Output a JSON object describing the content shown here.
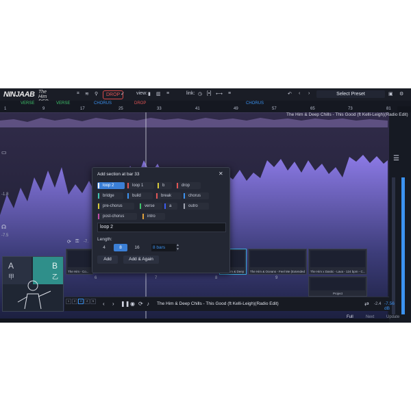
{
  "app": {
    "logo": "NINJAAB",
    "sublogo": "The Him DSP",
    "drop_label": "DROP",
    "view_label": "view:",
    "link_label": "link:",
    "preset_label": "Select Preset"
  },
  "sections": [
    {
      "label": "VERSE",
      "color": "#3fc46b"
    },
    {
      "label": "VERSE",
      "color": "#3fc46b"
    },
    {
      "label": "CHORUS",
      "color": "#3b92f0"
    },
    {
      "label": "DROP",
      "color": "#e05555"
    },
    {
      "label": "CHORUS",
      "color": "#3b92f0"
    }
  ],
  "ruler": [
    "1",
    "9",
    "17",
    "25",
    "33",
    "41",
    "49",
    "57",
    "65",
    "73",
    "81"
  ],
  "song_title": "The Him & Deep Chills - This Good (ft Kelli-Leigh)(Radio Edit)",
  "left_labels": {
    "label_a": "-1.8",
    "label_b": "-7.5",
    "label_c": "-7."
  },
  "dialog": {
    "title": "Add section at bar 33",
    "close": "✕",
    "chips": [
      {
        "label": "loop 2",
        "color": "#3b92f0",
        "selected": true
      },
      {
        "label": "loop 1",
        "color": "#e05555"
      },
      {
        "label": "b",
        "color": "#d6c93a"
      },
      {
        "label": "drop",
        "color": "#e05555"
      },
      {
        "label": "bridge",
        "color": "#3fc4b0"
      },
      {
        "label": "build",
        "color": "#3b92f0"
      },
      {
        "label": "break",
        "color": "#e05555"
      },
      {
        "label": "chorus",
        "color": "#3b92f0"
      },
      {
        "label": "pre-chorus",
        "color": "#d6c93a"
      },
      {
        "label": "verse",
        "color": "#3fc46b"
      },
      {
        "label": "a",
        "color": "#3b5bf0"
      },
      {
        "label": "outro",
        "color": "#a0a4b0"
      },
      {
        "label": "post-chorus",
        "color": "#c24aa8"
      },
      {
        "label": "intro",
        "color": "#e0a03a"
      }
    ],
    "input_value": "loop 2",
    "length_label": "Length:",
    "length_options": [
      "4",
      "8",
      "16"
    ],
    "length_selected": "8",
    "bars_value": "8 bars",
    "add_label": "Add",
    "add_again_label": "Add & Again"
  },
  "clips": [
    {
      "label": "The Him - Co..."
    },
    {
      "label": "The Him & Deep Chills - Th..."
    },
    {
      "label": "The Him & Oceans - Feel Me (Extended)"
    },
    {
      "label": "The Him x Dastic - Lava - 124 bpm - C..."
    },
    {
      "label": "Project"
    }
  ],
  "clip_numbers": [
    "6",
    "7",
    "8",
    "9"
  ],
  "art": {
    "a": "A",
    "b": "B",
    "c": "甲",
    "d": "乙"
  },
  "bottom": {
    "now_playing": "The Him & Deep Chills - This Good (ft Kelli-Leigh)(Radio Edit)",
    "db_small": "-2.4",
    "db_value": "-7.56 dB",
    "keys": [
      "1",
      "2",
      "3",
      "4",
      "5"
    ]
  },
  "tabs": [
    "Full",
    "Next",
    "Update"
  ]
}
